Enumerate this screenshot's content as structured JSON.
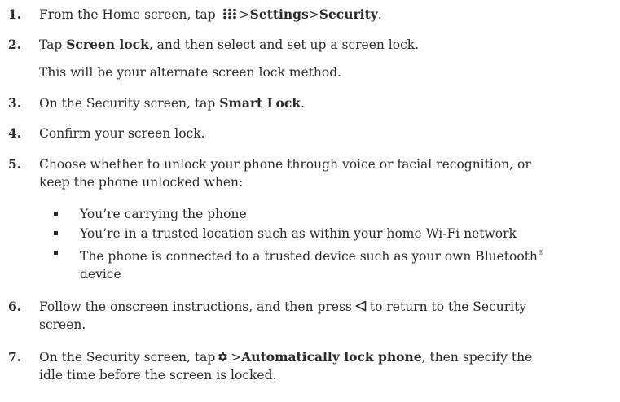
{
  "steps": [
    {
      "number": "1.",
      "lines": [
        {
          "parts": [
            "From the Home screen, tap",
            ">",
            "Settings",
            ">",
            "Security",
            "."
          ]
        }
      ]
    },
    {
      "number": "2.",
      "lines": [
        {
          "parts": [
            "Tap ",
            "Screen lock",
            ", and then select and set up a screen lock."
          ]
        },
        {
          "parts": [
            "This will be your alternate screen lock method."
          ]
        }
      ]
    },
    {
      "number": "3.",
      "lines": [
        {
          "parts": [
            "On the Security screen, tap ",
            "Smart Lock",
            "."
          ]
        }
      ]
    },
    {
      "number": "4.",
      "lines": [
        {
          "parts": [
            "Confirm your screen lock."
          ]
        }
      ]
    },
    {
      "number": "5.",
      "lines": [
        {
          "parts": [
            "Choose whether to unlock your phone through voice or facial recognition, or"
          ]
        },
        {
          "parts": [
            "keep the phone unlocked when:"
          ]
        }
      ]
    },
    {
      "number": "6.",
      "lines": [
        {
          "parts": [
            "Follow the onscreen instructions, and then press",
            "to return to the Security"
          ]
        },
        {
          "parts": [
            "screen."
          ]
        }
      ]
    },
    {
      "number": "7.",
      "lines": [
        {
          "parts": [
            "On the Security screen, tap",
            ">",
            "Automatically lock phone",
            ", then specify the"
          ]
        },
        {
          "parts": [
            "idle time before the screen is locked."
          ]
        }
      ]
    }
  ],
  "bullets": [
    {
      "line1": "You’re carrying the phone"
    },
    {
      "line1": "You’re in a trusted location such as within your home Wi-Fi network"
    },
    {
      "line1": "The phone is connected to a trusted device such as your own Bluetooth",
      "reg": "®",
      "line2": "device"
    }
  ],
  "icons": {
    "apps": "apps-grid-icon",
    "settings": "gear-icon",
    "back": "back-triangle-icon"
  },
  "colors": {
    "text": "#2b2b2b"
  }
}
